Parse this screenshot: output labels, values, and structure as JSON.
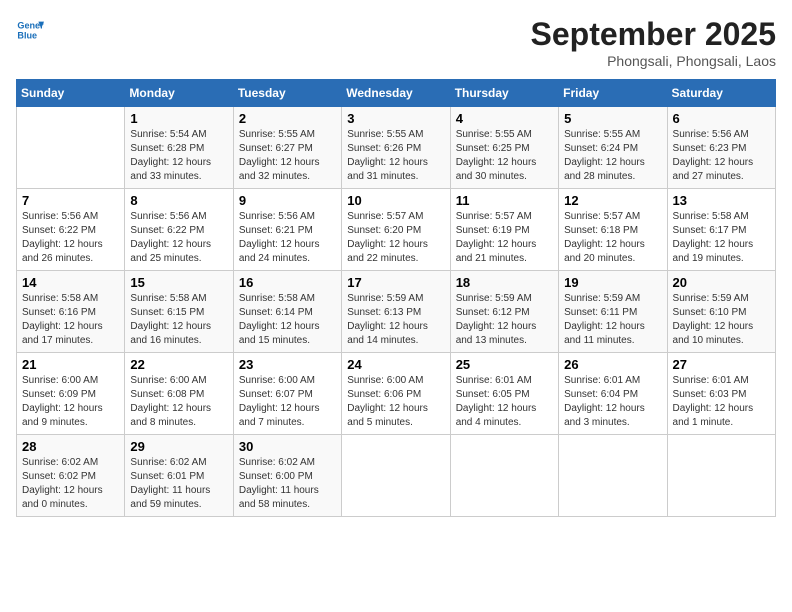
{
  "header": {
    "logo_line1": "General",
    "logo_line2": "Blue",
    "month": "September 2025",
    "location": "Phongsali, Phongsali, Laos"
  },
  "days_of_week": [
    "Sunday",
    "Monday",
    "Tuesday",
    "Wednesday",
    "Thursday",
    "Friday",
    "Saturday"
  ],
  "weeks": [
    [
      {
        "day": "",
        "text": ""
      },
      {
        "day": "1",
        "text": "Sunrise: 5:54 AM\nSunset: 6:28 PM\nDaylight: 12 hours\nand 33 minutes."
      },
      {
        "day": "2",
        "text": "Sunrise: 5:55 AM\nSunset: 6:27 PM\nDaylight: 12 hours\nand 32 minutes."
      },
      {
        "day": "3",
        "text": "Sunrise: 5:55 AM\nSunset: 6:26 PM\nDaylight: 12 hours\nand 31 minutes."
      },
      {
        "day": "4",
        "text": "Sunrise: 5:55 AM\nSunset: 6:25 PM\nDaylight: 12 hours\nand 30 minutes."
      },
      {
        "day": "5",
        "text": "Sunrise: 5:55 AM\nSunset: 6:24 PM\nDaylight: 12 hours\nand 28 minutes."
      },
      {
        "day": "6",
        "text": "Sunrise: 5:56 AM\nSunset: 6:23 PM\nDaylight: 12 hours\nand 27 minutes."
      }
    ],
    [
      {
        "day": "7",
        "text": "Sunrise: 5:56 AM\nSunset: 6:22 PM\nDaylight: 12 hours\nand 26 minutes."
      },
      {
        "day": "8",
        "text": "Sunrise: 5:56 AM\nSunset: 6:22 PM\nDaylight: 12 hours\nand 25 minutes."
      },
      {
        "day": "9",
        "text": "Sunrise: 5:56 AM\nSunset: 6:21 PM\nDaylight: 12 hours\nand 24 minutes."
      },
      {
        "day": "10",
        "text": "Sunrise: 5:57 AM\nSunset: 6:20 PM\nDaylight: 12 hours\nand 22 minutes."
      },
      {
        "day": "11",
        "text": "Sunrise: 5:57 AM\nSunset: 6:19 PM\nDaylight: 12 hours\nand 21 minutes."
      },
      {
        "day": "12",
        "text": "Sunrise: 5:57 AM\nSunset: 6:18 PM\nDaylight: 12 hours\nand 20 minutes."
      },
      {
        "day": "13",
        "text": "Sunrise: 5:58 AM\nSunset: 6:17 PM\nDaylight: 12 hours\nand 19 minutes."
      }
    ],
    [
      {
        "day": "14",
        "text": "Sunrise: 5:58 AM\nSunset: 6:16 PM\nDaylight: 12 hours\nand 17 minutes."
      },
      {
        "day": "15",
        "text": "Sunrise: 5:58 AM\nSunset: 6:15 PM\nDaylight: 12 hours\nand 16 minutes."
      },
      {
        "day": "16",
        "text": "Sunrise: 5:58 AM\nSunset: 6:14 PM\nDaylight: 12 hours\nand 15 minutes."
      },
      {
        "day": "17",
        "text": "Sunrise: 5:59 AM\nSunset: 6:13 PM\nDaylight: 12 hours\nand 14 minutes."
      },
      {
        "day": "18",
        "text": "Sunrise: 5:59 AM\nSunset: 6:12 PM\nDaylight: 12 hours\nand 13 minutes."
      },
      {
        "day": "19",
        "text": "Sunrise: 5:59 AM\nSunset: 6:11 PM\nDaylight: 12 hours\nand 11 minutes."
      },
      {
        "day": "20",
        "text": "Sunrise: 5:59 AM\nSunset: 6:10 PM\nDaylight: 12 hours\nand 10 minutes."
      }
    ],
    [
      {
        "day": "21",
        "text": "Sunrise: 6:00 AM\nSunset: 6:09 PM\nDaylight: 12 hours\nand 9 minutes."
      },
      {
        "day": "22",
        "text": "Sunrise: 6:00 AM\nSunset: 6:08 PM\nDaylight: 12 hours\nand 8 minutes."
      },
      {
        "day": "23",
        "text": "Sunrise: 6:00 AM\nSunset: 6:07 PM\nDaylight: 12 hours\nand 7 minutes."
      },
      {
        "day": "24",
        "text": "Sunrise: 6:00 AM\nSunset: 6:06 PM\nDaylight: 12 hours\nand 5 minutes."
      },
      {
        "day": "25",
        "text": "Sunrise: 6:01 AM\nSunset: 6:05 PM\nDaylight: 12 hours\nand 4 minutes."
      },
      {
        "day": "26",
        "text": "Sunrise: 6:01 AM\nSunset: 6:04 PM\nDaylight: 12 hours\nand 3 minutes."
      },
      {
        "day": "27",
        "text": "Sunrise: 6:01 AM\nSunset: 6:03 PM\nDaylight: 12 hours\nand 1 minute."
      }
    ],
    [
      {
        "day": "28",
        "text": "Sunrise: 6:02 AM\nSunset: 6:02 PM\nDaylight: 12 hours\nand 0 minutes."
      },
      {
        "day": "29",
        "text": "Sunrise: 6:02 AM\nSunset: 6:01 PM\nDaylight: 11 hours\nand 59 minutes."
      },
      {
        "day": "30",
        "text": "Sunrise: 6:02 AM\nSunset: 6:00 PM\nDaylight: 11 hours\nand 58 minutes."
      },
      {
        "day": "",
        "text": ""
      },
      {
        "day": "",
        "text": ""
      },
      {
        "day": "",
        "text": ""
      },
      {
        "day": "",
        "text": ""
      }
    ]
  ]
}
